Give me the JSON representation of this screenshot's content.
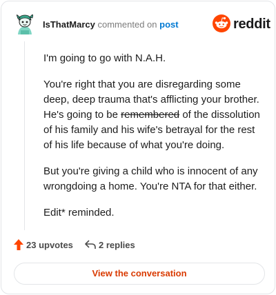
{
  "header": {
    "username": "IsThatMarcy",
    "action_text": "commented on",
    "target_text": "post",
    "brand": "reddit"
  },
  "comment": {
    "paragraph1": "I'm going to go with N.A.H.",
    "paragraph2_before": "You're right that you are disregarding some deep, deep trauma that's afflicting your brother. He's going to be ",
    "paragraph2_strike": "remembered",
    "paragraph2_after": " of the dissolution of his family and his wife's betrayal for the rest of his life because of what you're doing.",
    "paragraph3": "But you're giving a child who is innocent of any wrongdoing a home. You're NTA for that either.",
    "paragraph4": "Edit* reminded."
  },
  "actions": {
    "upvotes": "23 upvotes",
    "replies": "2 replies"
  },
  "cta": {
    "label": "View the conversation"
  },
  "colors": {
    "reddit_orange": "#ff4500",
    "link_blue": "#0079d3",
    "cta_text": "#d93a00"
  },
  "icons": {
    "avatar": "snoo-avatar-icon",
    "brand": "reddit-logo-icon",
    "upvote": "upvote-arrow-icon",
    "reply": "reply-arrow-icon"
  }
}
